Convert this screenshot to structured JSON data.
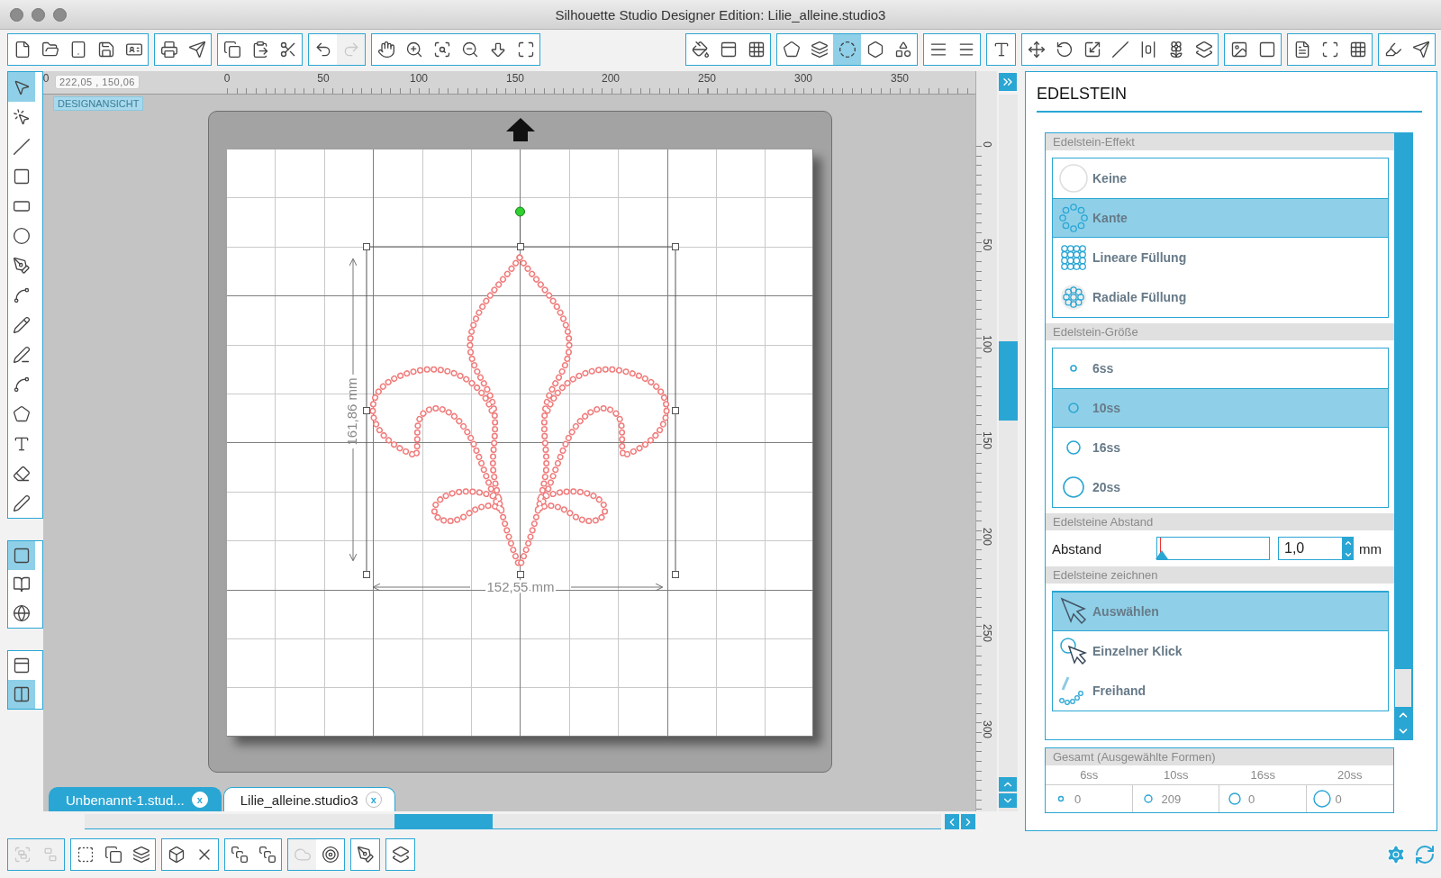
{
  "window": {
    "title": "Silhouette Studio Designer Edition: Lilie_alleine.studio3"
  },
  "top_toolbar": {
    "groups": [
      [
        {
          "selected": false,
          "disabled": false
        },
        {
          "selected": false,
          "disabled": false
        },
        {
          "selected": false,
          "disabled": false
        },
        {
          "selected": false,
          "disabled": false
        },
        {
          "selected": false,
          "disabled": false
        }
      ],
      [
        {
          "selected": false,
          "disabled": false
        },
        {
          "selected": false,
          "disabled": false
        }
      ],
      [
        {
          "selected": false,
          "disabled": false
        },
        {
          "selected": false,
          "disabled": false
        },
        {
          "selected": false,
          "disabled": false
        }
      ],
      [
        {
          "selected": false,
          "disabled": false
        },
        {
          "selected": false,
          "disabled": true
        }
      ],
      [
        {
          "selected": false,
          "disabled": false
        },
        {
          "selected": false,
          "disabled": false
        },
        {
          "selected": false,
          "disabled": false
        },
        {
          "selected": false,
          "disabled": false
        },
        {
          "selected": false,
          "disabled": false
        },
        {
          "selected": false,
          "disabled": false
        }
      ],
      [
        {
          "selected": false,
          "disabled": false
        },
        {
          "selected": false,
          "disabled": false
        },
        {
          "selected": false,
          "disabled": false
        }
      ],
      [
        {
          "selected": false,
          "disabled": false
        },
        {
          "selected": false,
          "disabled": false
        },
        {
          "selected": true,
          "disabled": false
        },
        {
          "selected": false,
          "disabled": false
        },
        {
          "selected": false,
          "disabled": false
        }
      ],
      [
        {
          "selected": false,
          "disabled": false
        },
        {
          "selected": false,
          "disabled": false
        }
      ],
      [
        {
          "selected": false,
          "disabled": false
        }
      ],
      [
        {
          "selected": false,
          "disabled": false
        },
        {
          "selected": false,
          "disabled": false
        },
        {
          "selected": false,
          "disabled": false
        },
        {
          "selected": false,
          "disabled": false
        },
        {
          "selected": false,
          "disabled": false
        },
        {
          "selected": false,
          "disabled": false
        },
        {
          "selected": false,
          "disabled": false
        }
      ],
      [
        {
          "selected": false,
          "disabled": false
        },
        {
          "selected": false,
          "disabled": false
        }
      ],
      [
        {
          "selected": false,
          "disabled": false
        },
        {
          "selected": false,
          "disabled": false
        },
        {
          "selected": false,
          "disabled": false
        }
      ],
      [
        {
          "selected": false,
          "disabled": false
        },
        {
          "selected": false,
          "disabled": false
        }
      ]
    ]
  },
  "left_toolbar": {
    "groups": [
      [
        {
          "selected": true
        },
        {
          "selected": false
        },
        {
          "selected": false
        },
        {
          "selected": false
        },
        {
          "selected": false
        },
        {
          "selected": false
        },
        {
          "selected": false
        },
        {
          "selected": false
        },
        {
          "selected": false
        },
        {
          "selected": false
        },
        {
          "selected": false
        },
        {
          "selected": false
        },
        {
          "selected": false
        },
        {
          "selected": false
        },
        {
          "selected": false
        }
      ],
      [
        {
          "selected": true
        },
        {
          "selected": false
        },
        {
          "selected": false
        }
      ],
      [
        {
          "selected": false
        },
        {
          "selected": true
        }
      ]
    ]
  },
  "ruler": {
    "coordinates": "222,05 , 150,06",
    "top_labels": [
      "0",
      "0",
      "50",
      "100",
      "150",
      "200",
      "250",
      "300",
      "350"
    ],
    "side_labels": [
      "0",
      "50",
      "100",
      "150",
      "200",
      "250",
      "300"
    ]
  },
  "view_badge": "DESIGNANSICHT",
  "canvas": {
    "height_label": "161,86 mm",
    "width_label": "152,55 mm"
  },
  "document_tabs": [
    {
      "label": "Unbenannt-1.stud...",
      "close": "x",
      "selected": false
    },
    {
      "label": "Lilie_alleine.studio3",
      "close": "x",
      "selected": true
    }
  ],
  "bottom_toolbar": {
    "groups": [
      [
        {
          "disabled": true
        },
        {
          "disabled": true
        }
      ],
      [
        {
          "disabled": false
        },
        {
          "disabled": false
        },
        {
          "disabled": false
        }
      ],
      [
        {
          "disabled": false
        },
        {
          "disabled": false
        }
      ],
      [
        {
          "disabled": false
        },
        {
          "disabled": false
        }
      ],
      [
        {
          "disabled": true
        },
        {
          "disabled": false
        }
      ],
      [
        {
          "disabled": false
        }
      ],
      [
        {
          "disabled": false
        }
      ]
    ]
  },
  "panel": {
    "title": "EDELSTEIN",
    "sections": [
      {
        "kind": "list",
        "title": "Edelstein-Effekt",
        "items": [
          {
            "label": "Keine",
            "selected": false
          },
          {
            "label": "Kante",
            "selected": true
          },
          {
            "label": "Lineare Füllung",
            "selected": false
          },
          {
            "label": "Radiale Füllung",
            "selected": false
          }
        ]
      },
      {
        "kind": "list",
        "title": "Edelstein-Größe",
        "items": [
          {
            "label": "6ss",
            "selected": false
          },
          {
            "label": "10ss",
            "selected": true
          },
          {
            "label": "16ss",
            "selected": false
          },
          {
            "label": "20ss",
            "selected": false
          }
        ]
      },
      {
        "kind": "spacing",
        "title": "Edelsteine Abstand",
        "label": "Abstand",
        "level": 0.03,
        "value": "1,0",
        "unit": "mm"
      },
      {
        "kind": "list",
        "title": "Edelsteine zeichnen",
        "items": [
          {
            "label": "Auswählen",
            "selected": true
          },
          {
            "label": "Einzelner Klick",
            "selected": false
          },
          {
            "label": "Freihand",
            "selected": false
          }
        ]
      }
    ],
    "totals": {
      "title": "Gesamt (Ausgewählte Formen)",
      "columns": [
        "6ss",
        "10ss",
        "16ss",
        "20ss"
      ],
      "values": [
        "0",
        "209",
        "0",
        "0"
      ]
    }
  }
}
